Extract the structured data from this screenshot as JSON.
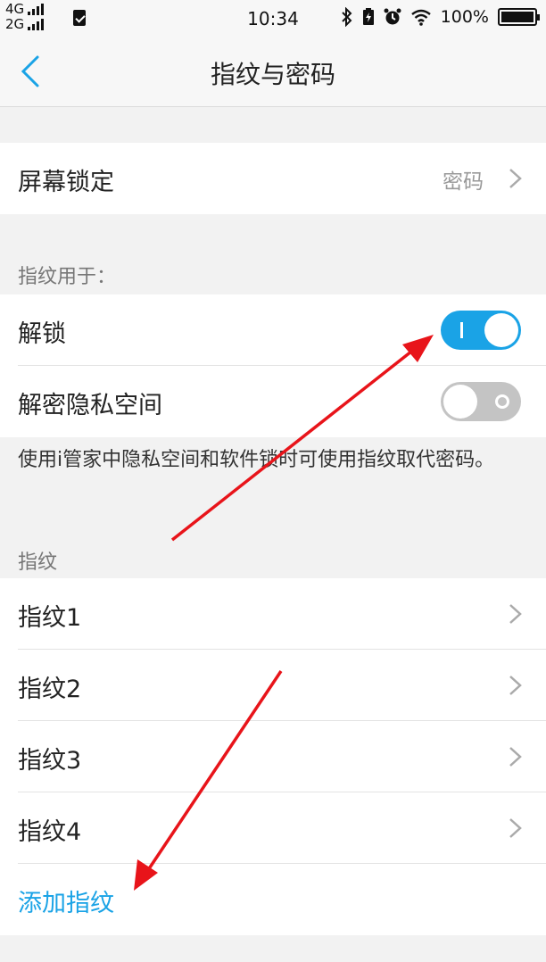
{
  "status_bar": {
    "network_1": "4G",
    "network_2": "2G",
    "time": "10:34",
    "battery": "100%",
    "icons": [
      "sim-card-icon",
      "bluetooth-icon",
      "battery-saver-icon",
      "alarm-icon",
      "wifi-icon",
      "battery-icon"
    ]
  },
  "header": {
    "title": "指纹与密码",
    "back_icon": "chevron-left-icon"
  },
  "screen_lock": {
    "label": "屏幕锁定",
    "value": "密码"
  },
  "fingerprint_usage": {
    "section_title": "指纹用于：",
    "unlock": {
      "label": "解锁",
      "enabled": true
    },
    "private_space": {
      "label": "解密隐私空间",
      "enabled": false
    },
    "description": "使用i管家中隐私空间和软件锁时可使用指纹取代密码。"
  },
  "fingerprints": {
    "section_title": "指纹",
    "items": [
      {
        "label": "指纹1"
      },
      {
        "label": "指纹2"
      },
      {
        "label": "指纹3"
      },
      {
        "label": "指纹4"
      }
    ],
    "add_label": "添加指纹"
  },
  "colors": {
    "accent": "#1aa3e6",
    "annotation_arrow": "#e8141a",
    "toggle_off": "#c4c4c4"
  }
}
